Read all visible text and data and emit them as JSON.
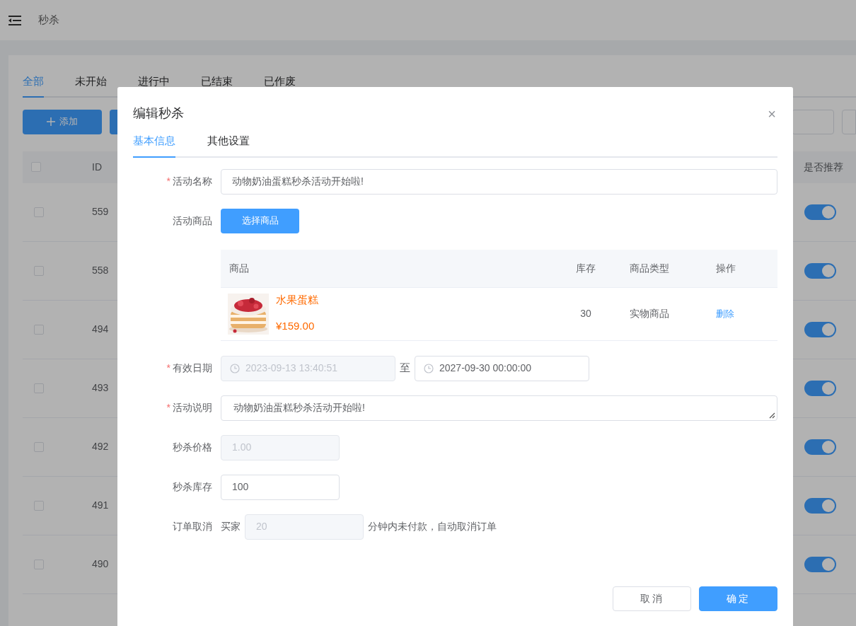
{
  "header": {
    "title": "秒杀"
  },
  "tabs": [
    {
      "label": "全部",
      "selected": true
    },
    {
      "label": "未开始",
      "selected": false
    },
    {
      "label": "进行中",
      "selected": false
    },
    {
      "label": "已结束",
      "selected": false
    },
    {
      "label": "已作废",
      "selected": false
    }
  ],
  "toolbar": {
    "add_button": "添加"
  },
  "table": {
    "columns": [
      "ID",
      "是否推荐"
    ],
    "header_checked": false,
    "rows": [
      {
        "id": "559",
        "checked": false,
        "recommended": true
      },
      {
        "id": "558",
        "checked": false,
        "recommended": true
      },
      {
        "id": "494",
        "checked": false,
        "recommended": true
      },
      {
        "id": "493",
        "checked": false,
        "recommended": true
      },
      {
        "id": "492",
        "checked": false,
        "recommended": true
      },
      {
        "id": "491",
        "checked": false,
        "recommended": true
      },
      {
        "id": "490",
        "checked": false,
        "recommended": true
      }
    ]
  },
  "dialog": {
    "title": "编辑秒杀",
    "close": "×",
    "tabs": [
      {
        "label": "基本信息",
        "selected": true
      },
      {
        "label": "其他设置",
        "selected": false
      }
    ],
    "fields": [
      {
        "kind": "text",
        "required_mark": "*",
        "label": "活动名称",
        "value": "动物奶油蛋糕秒杀活动开始啦!",
        "disabled": false
      },
      {
        "kind": "product",
        "label": "活动商品",
        "button": "选择商品",
        "columns": [
          "商品",
          "库存",
          "商品类型",
          "操作"
        ],
        "items": [
          {
            "name": "水果蛋糕",
            "price": "¥159.00",
            "stock": "30",
            "type": "实物商品",
            "action": "删除"
          }
        ]
      },
      {
        "kind": "daterange",
        "required_mark": "*",
        "label": "有效日期",
        "start": "2023-09-13 13:40:51",
        "start_disabled": true,
        "separator": "至",
        "end": "2027-09-30 00:00:00",
        "end_disabled": false
      },
      {
        "kind": "textarea",
        "required_mark": "*",
        "label": "活动说明",
        "value": "动物奶油蛋糕秒杀活动开始啦!",
        "disabled": false
      },
      {
        "kind": "short",
        "label": "秒杀价格",
        "value": "1.00",
        "disabled": true
      },
      {
        "kind": "short",
        "label": "秒杀库存",
        "value": "100",
        "disabled": false
      },
      {
        "kind": "cancel",
        "label": "订单取消",
        "prefix": "买家",
        "value": "20",
        "disabled": true,
        "suffix": "分钟内未付款，自动取消订单"
      }
    ],
    "buttons": [
      {
        "label": "取消",
        "kind": "secondary"
      },
      {
        "label": "确定",
        "kind": "primary"
      }
    ]
  }
}
